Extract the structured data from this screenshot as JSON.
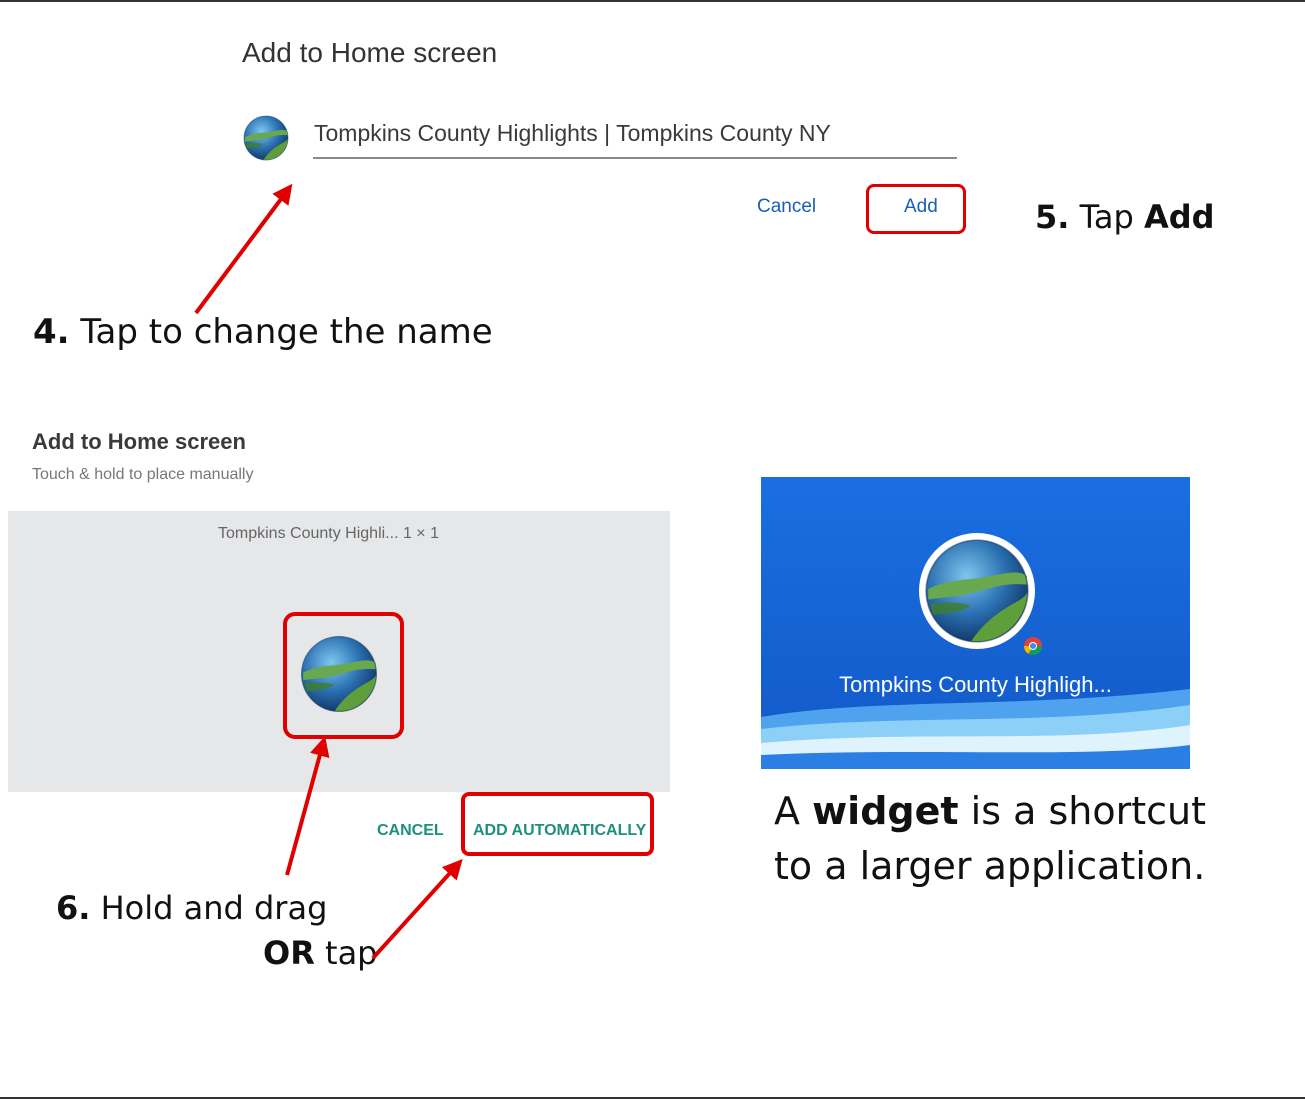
{
  "dialog1": {
    "title": "Add to Home screen",
    "name_value": "Tompkins County Highlights | Tompkins County NY",
    "cancel_label": "Cancel",
    "add_label": "Add"
  },
  "dialog2": {
    "title": "Add to Home screen",
    "subtitle": "Touch & hold to place manually",
    "widget_label": "Tompkins County Highli...  1 × 1",
    "cancel_label": "CANCEL",
    "add_auto_label": "ADD AUTOMATICALLY"
  },
  "home_screen": {
    "icon_label": "Tompkins County Highligh..."
  },
  "captions": {
    "step4_num": "4.",
    "step4_text": " Tap to change the name",
    "step5_num": "5.",
    "step5_text": " Tap ",
    "step5_bold": "Add",
    "step6_num": "6.",
    "step6_text": " Hold and drag",
    "or_bold": "OR",
    "or_text": " tap",
    "widget_line1_pre": "A ",
    "widget_line1_bold": "widget",
    "widget_line1_post": " is a shortcut",
    "widget_line2": "to a larger application."
  },
  "icons": {
    "site_icon": "globe-landscape-icon",
    "browser_badge": "chrome-badge-icon"
  },
  "colors": {
    "highlight_red": "#e00000",
    "dialog1_button_blue": "#1a5fb4",
    "dialog2_button_teal": "#1f8f7d",
    "home_screen_blue": "#1565d8"
  }
}
